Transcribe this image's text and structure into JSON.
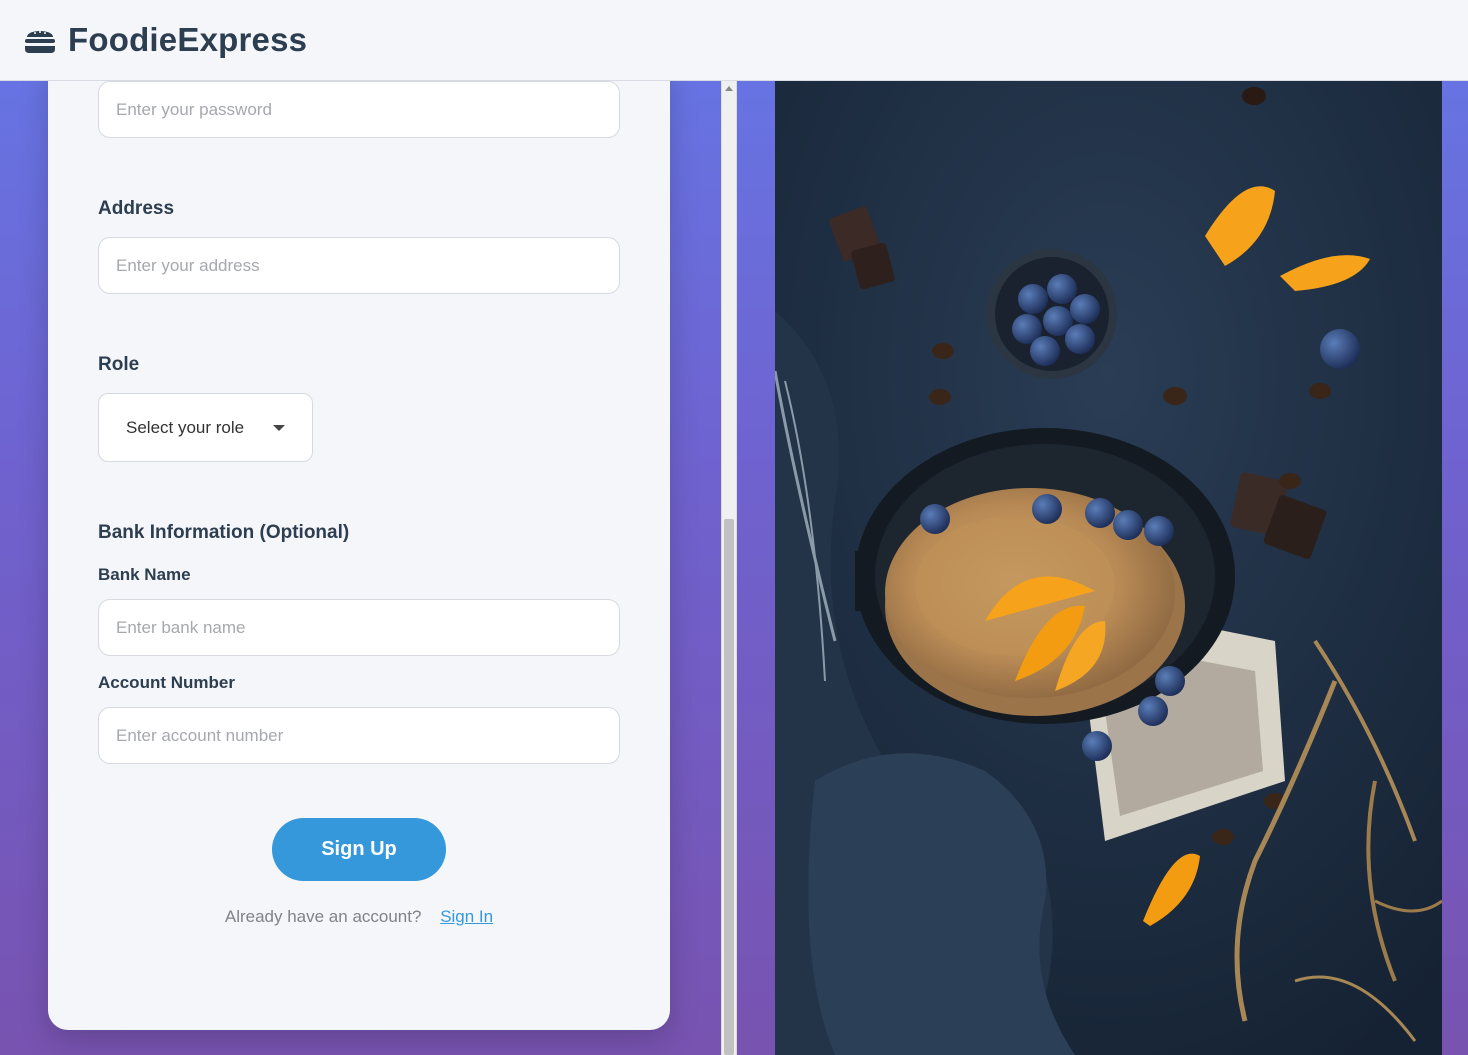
{
  "header": {
    "brand_name": "FoodieExpress",
    "brand_icon": "hamburger-icon",
    "text_color": "#2c3e50"
  },
  "form": {
    "password": {
      "placeholder": "Enter your password"
    },
    "address": {
      "label": "Address",
      "placeholder": "Enter your address"
    },
    "role": {
      "label": "Role",
      "selected": "Select your role"
    },
    "bank_section_title": "Bank Information (Optional)",
    "bank_name": {
      "label": "Bank Name",
      "placeholder": "Enter bank name"
    },
    "account_number": {
      "label": "Account Number",
      "placeholder": "Enter account number"
    },
    "submit_label": "Sign Up",
    "signin_prompt": "Already have an account?",
    "signin_link": "Sign In"
  },
  "colors": {
    "accent": "#3498db",
    "background_top": "#6577e6",
    "background_bottom": "#7853b0",
    "card": "#f5f6fa"
  },
  "photo": {
    "description_icon": "food-photo-image"
  }
}
